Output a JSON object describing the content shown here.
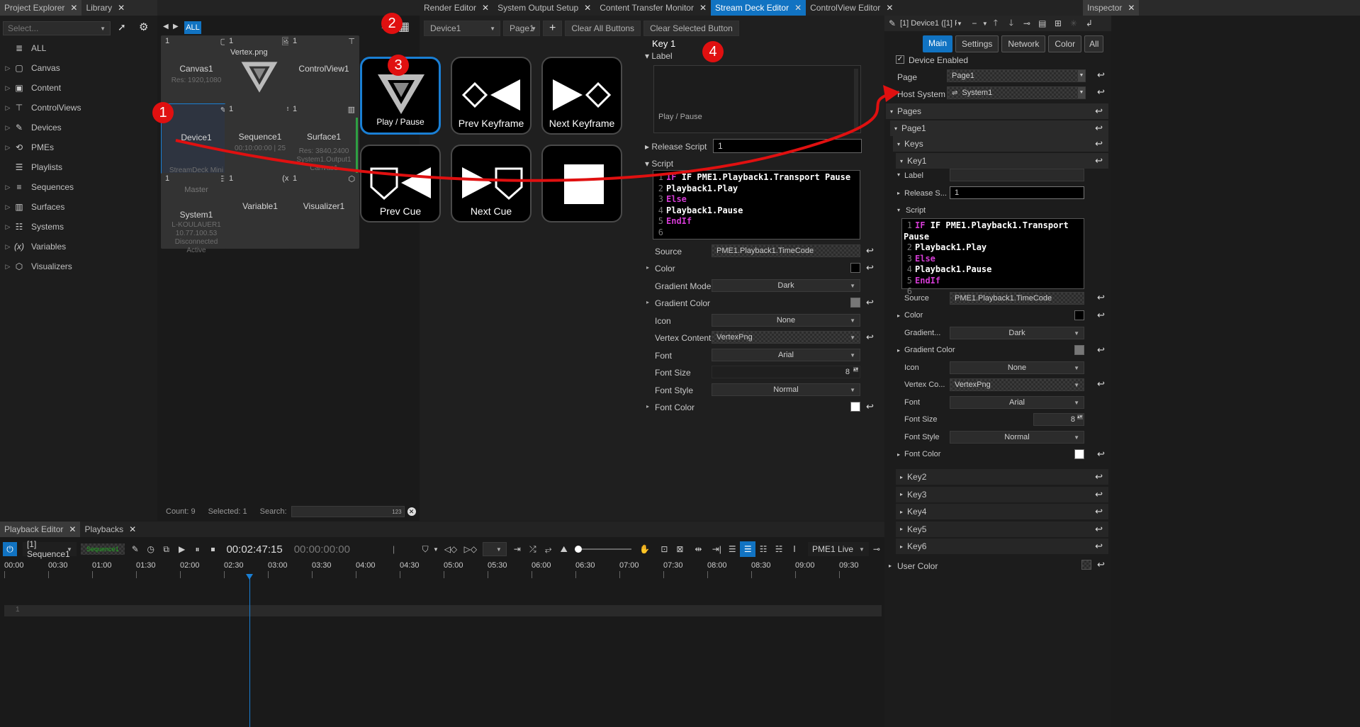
{
  "top_tabs_left": [
    {
      "label": "Project Explorer"
    },
    {
      "label": "Library"
    }
  ],
  "top_tabs_center": [
    {
      "label": "Render Editor"
    },
    {
      "label": "System Output Setup"
    },
    {
      "label": "Content Transfer Monitor"
    },
    {
      "label": "Stream Deck Editor"
    },
    {
      "label": "ControlView Editor"
    }
  ],
  "top_tabs_right": [
    {
      "label": "Inspector"
    }
  ],
  "explorer": {
    "select_placeholder": "Select...",
    "items": [
      {
        "label": "ALL",
        "icon": "database-icon"
      },
      {
        "label": "Canvas",
        "icon": "canvas-icon"
      },
      {
        "label": "Content",
        "icon": "content-icon"
      },
      {
        "label": "ControlViews",
        "icon": "controlview-icon"
      },
      {
        "label": "Devices",
        "icon": "device-icon"
      },
      {
        "label": "PMEs",
        "icon": "pme-icon"
      },
      {
        "label": "Playlists",
        "icon": "playlist-icon"
      },
      {
        "label": "Sequences",
        "icon": "sequence-icon"
      },
      {
        "label": "Surfaces",
        "icon": "surface-icon"
      },
      {
        "label": "Systems",
        "icon": "system-icon"
      },
      {
        "label": "Variables",
        "icon": "variable-icon"
      },
      {
        "label": "Visualizers",
        "icon": "visualizer-icon"
      }
    ]
  },
  "library": {
    "filter_all": "ALL",
    "sort_badge": "123",
    "cards": [
      {
        "num": "1",
        "name": "Canvas1",
        "sub": "Res: 1920,1080",
        "icon": "canvas-icon"
      },
      {
        "num": "1",
        "name": "Vertex.png",
        "sub": "",
        "icon": "image-icon"
      },
      {
        "num": "1",
        "name": "ControlView1",
        "sub": "",
        "icon": "controlview-icon"
      },
      {
        "num": "1",
        "name": "Device1",
        "sub": "StreamDeck Mini",
        "icon": "device-icon"
      },
      {
        "num": "1",
        "name": "Sequence1",
        "sub": "00:10:00:00 | 25",
        "icon": "sequence-icon"
      },
      {
        "num": "1",
        "name": "Surface1",
        "sub": "Res: 3840,2400\nSystem1.Output1\nCanvas1",
        "icon": "surface-icon"
      },
      {
        "num": "1",
        "name": "System1",
        "sub": "L-KOULAUER1\n10.77.100.53\nDisconnected\nActive",
        "top": "Master",
        "icon": "system-icon"
      },
      {
        "num": "1",
        "name": "Variable1",
        "sub": "",
        "icon": "variable-icon"
      },
      {
        "num": "1",
        "name": "Visualizer1",
        "sub": "",
        "icon": "visualizer-icon"
      }
    ],
    "footer": {
      "count": "Count: 9",
      "selected": "Selected: 1",
      "search_label": "Search:"
    }
  },
  "streamdeck": {
    "device": "Device1",
    "page": "Page1",
    "clear_all": "Clear All Buttons",
    "clear_selected": "Clear Selected Button",
    "keys": [
      {
        "label": "Play / Pause"
      },
      {
        "label": "Prev Keyframe"
      },
      {
        "label": "Next Keyframe"
      },
      {
        "label": "Prev Cue"
      },
      {
        "label": "Next Cue"
      },
      {
        "label": ""
      }
    ]
  },
  "key_props": {
    "title": "Key 1",
    "label_section": "Label",
    "label_value": "Play / Pause",
    "release_script": "Release Script",
    "release_value": "1",
    "script_section": "Script",
    "script_lines": [
      "IF PME1.Playback1.Transport Pause",
      "Playback1.Play",
      "Else",
      "Playback1.Pause",
      "EndIf",
      ""
    ],
    "source": "Source",
    "source_value": "PME1.Playback1.TimeCode",
    "color": "Color",
    "gradient_mode": "Gradient Mode",
    "gradient_mode_value": "Dark",
    "gradient_color": "Gradient Color",
    "icon": "Icon",
    "icon_value": "None",
    "vertex_content": "Vertex Content",
    "vertex_value": "VertexPng",
    "font": "Font",
    "font_value": "Arial",
    "font_size": "Font Size",
    "font_size_value": "8",
    "font_style": "Font Style",
    "font_style_value": "Normal",
    "font_color": "Font Color"
  },
  "inspector": {
    "object": "[1] Device1 ([1] Proc",
    "tabs": [
      {
        "label": "Main"
      },
      {
        "label": "Settings"
      },
      {
        "label": "Network"
      },
      {
        "label": "Color"
      },
      {
        "label": "All"
      }
    ],
    "device_enabled": "Device Enabled",
    "page": "Page",
    "page_value": "Page1",
    "host": "Host System",
    "host_value": "System1",
    "pages": "Pages",
    "page1": "Page1",
    "keys": "Keys",
    "key1": "Key1",
    "label": "Label",
    "release": "Release S...",
    "release_value": "1",
    "script": "Script",
    "source": "Source",
    "source_value": "PME1.Playback1.TimeCode",
    "color": "Color",
    "gradient": "Gradient...",
    "gradient_value": "Dark",
    "gradient_color": "Gradient Color",
    "icon": "Icon",
    "icon_value": "None",
    "vertex": "Vertex Co...",
    "vertex_value": "VertexPng",
    "font": "Font",
    "font_value": "Arial",
    "font_size": "Font Size",
    "font_size_value": "8",
    "font_style": "Font Style",
    "font_style_value": "Normal",
    "font_color": "Font Color",
    "other_keys": [
      "Key2",
      "Key3",
      "Key4",
      "Key5",
      "Key6"
    ],
    "user_color": "User Color"
  },
  "bottom_tabs": [
    {
      "label": "Playback Editor"
    },
    {
      "label": "Playbacks"
    }
  ],
  "playback": {
    "sequence": "[1] Sequence1",
    "seq_chip": "Sequence1",
    "time_current": "00:02:47:15",
    "time_zero": "00:00:00:00",
    "output": "PME1 Live",
    "ruler": [
      "00:00",
      "00:30",
      "01:00",
      "01:30",
      "02:00",
      "02:30",
      "03:00",
      "03:30",
      "04:00",
      "04:30",
      "05:00",
      "05:30",
      "06:00",
      "06:30",
      "07:00",
      "07:30",
      "08:00",
      "08:30",
      "09:00",
      "09:30"
    ],
    "track_num": "1",
    "playhead_fraction": 0.2792
  },
  "callouts": [
    "1",
    "2",
    "3",
    "4"
  ],
  "colors": {
    "accent": "#1173c2",
    "callout": "#e01010",
    "green": "#2ea043"
  }
}
